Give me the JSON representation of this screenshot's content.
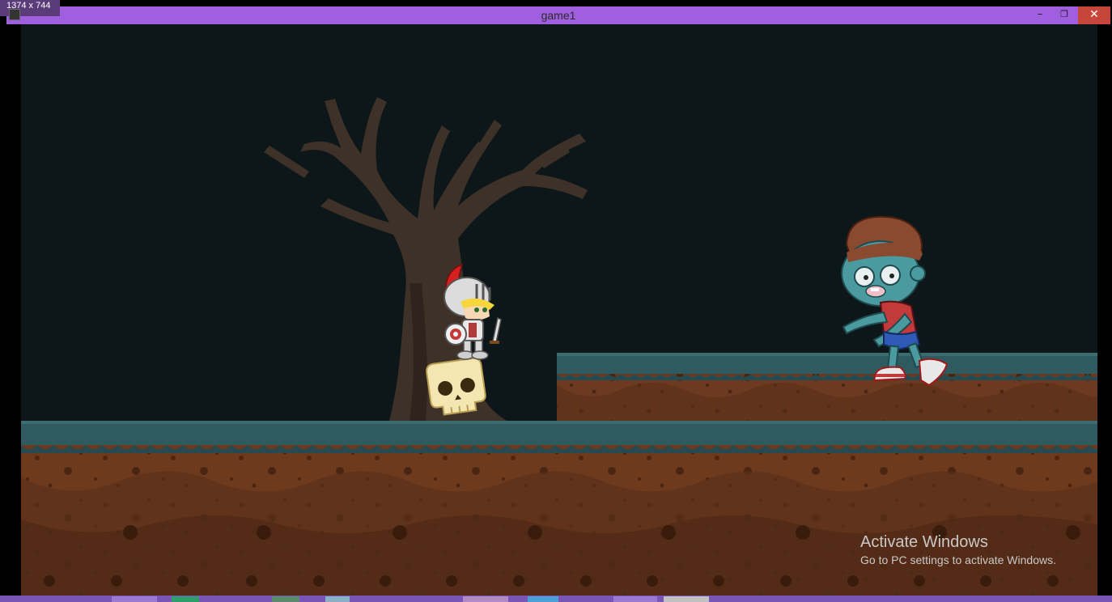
{
  "window": {
    "title": "game1",
    "dimensions_label": "1374 x 744",
    "minimize_label": "–",
    "maximize_label": "❐",
    "close_label": "✕"
  },
  "scene": {
    "player": "knight",
    "enemy": "zombie",
    "pickup": "skull"
  },
  "watermark": {
    "title": "Activate Windows",
    "subtitle": "Go to PC settings to activate Windows."
  },
  "colors": {
    "titlebar": "#a05fdf",
    "sky": "#0d1618",
    "grass": "#2e5a60",
    "dirt": "#6e3a1e",
    "close": "#c7463b"
  }
}
